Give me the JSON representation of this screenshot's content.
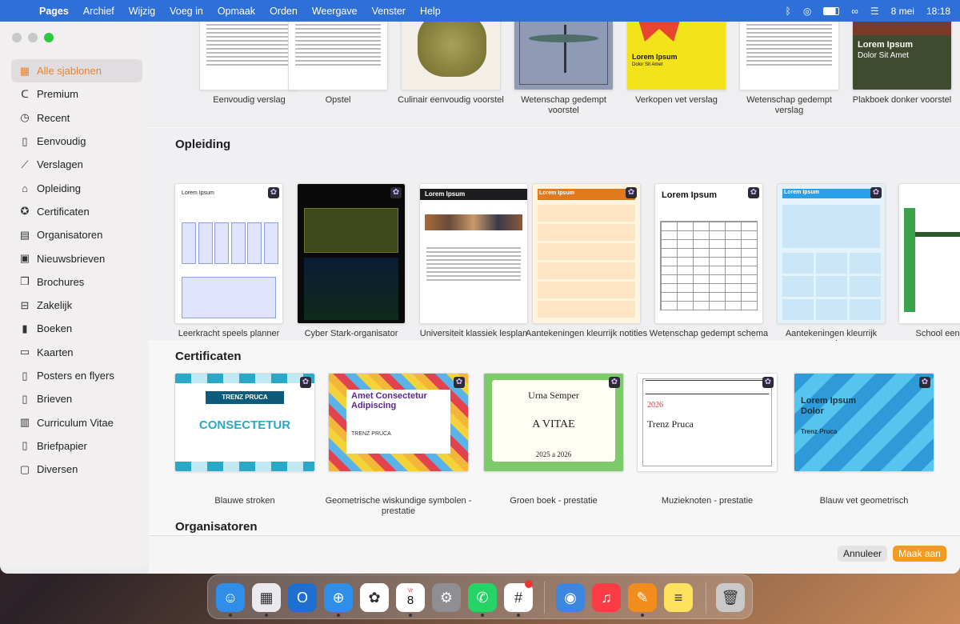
{
  "menubar": {
    "apple": "",
    "items": [
      "Pages",
      "Archief",
      "Wijzig",
      "Voeg in",
      "Opmaak",
      "Orden",
      "Weergave",
      "Venster",
      "Help"
    ],
    "date": "8 mei",
    "time": "18:18"
  },
  "sidebar": {
    "items": [
      {
        "label": "Alle sjablonen",
        "icon": "grid-icon",
        "glyph": "▦",
        "active": true
      },
      {
        "label": "Premium",
        "icon": "premium-icon",
        "glyph": "ᑕ"
      },
      {
        "label": "Recent",
        "icon": "clock-icon",
        "glyph": "◷"
      },
      {
        "label": "Eenvoudig",
        "icon": "document-icon",
        "glyph": "▯"
      },
      {
        "label": "Verslagen",
        "icon": "trend-icon",
        "glyph": "⟋"
      },
      {
        "label": "Opleiding",
        "icon": "graduation-cap-icon",
        "glyph": "⌂"
      },
      {
        "label": "Certificaten",
        "icon": "ribbon-icon",
        "glyph": "✪"
      },
      {
        "label": "Organisatoren",
        "icon": "calendar-icon",
        "glyph": "▤"
      },
      {
        "label": "Nieuwsbrieven",
        "icon": "newsletter-icon",
        "glyph": "▣"
      },
      {
        "label": "Brochures",
        "icon": "brochure-icon",
        "glyph": "❐"
      },
      {
        "label": "Zakelijk",
        "icon": "briefcase-icon",
        "glyph": "⊟"
      },
      {
        "label": "Boeken",
        "icon": "book-icon",
        "glyph": "▮"
      },
      {
        "label": "Kaarten",
        "icon": "card-icon",
        "glyph": "▭"
      },
      {
        "label": "Posters en flyers",
        "icon": "poster-icon",
        "glyph": "▯"
      },
      {
        "label": "Brieven",
        "icon": "letter-icon",
        "glyph": "▯"
      },
      {
        "label": "Curriculum Vitae",
        "icon": "cv-icon",
        "glyph": "▥"
      },
      {
        "label": "Briefpapier",
        "icon": "stationery-icon",
        "glyph": "▯"
      },
      {
        "label": "Diversen",
        "icon": "misc-icon",
        "glyph": "▢"
      }
    ]
  },
  "sections": {
    "top_row": [
      {
        "caption": "Eenvoudig verslag",
        "bg": "#ffffff"
      },
      {
        "caption": "Opstel",
        "bg": "#ffffff"
      },
      {
        "caption": "Culinair eenvoudig voorstel",
        "bg": "#f3efe6"
      },
      {
        "caption": "Wetenschap gedempt voorstel",
        "bg": "#8f9bb5"
      },
      {
        "caption": "Verkopen vet verslag",
        "bg": "#f4e21a"
      },
      {
        "caption": "Wetenschap gedempt verslag",
        "bg": "#ffffff"
      },
      {
        "caption": "Plakboek donker voorstel",
        "bg": "#3f4a30"
      }
    ],
    "top_row_thumb_text": {
      "lorem": "Lorem Ipsum",
      "dolor": "Dolor Sit Amet"
    },
    "opleiding": {
      "title": "Opleiding",
      "items": [
        {
          "caption": "Leerkracht speels planner",
          "bg": "#ffffff",
          "accent": "#8e9ce8"
        },
        {
          "caption": "Cyber Stark-organisator",
          "bg": "#0a0a0a",
          "accent": "#4a5a20"
        },
        {
          "caption": "Universiteit klassiek lesplan",
          "bg": "#ffffff",
          "accent": "#222222"
        },
        {
          "caption": "Aantekeningen kleurrijk notities",
          "bg": "#fff4e0",
          "accent": "#e07a1e"
        },
        {
          "caption": "Wetenschap gedempt schema",
          "bg": "#ffffff",
          "accent": "#cfa27a"
        },
        {
          "caption": "Aantekeningen kleurrijk organizer",
          "bg": "#e3f2fb",
          "accent": "#2aa0e8"
        },
        {
          "caption": "School een lesplan",
          "bg": "#ffffff",
          "accent": "#3aa24a"
        }
      ],
      "thumb_text": "Lorem Ipsum"
    },
    "certificaten": {
      "title": "Certificaten",
      "items": [
        {
          "caption": "Blauwe stroken",
          "bg": "#ffffff",
          "accent": "#29a9c7",
          "line1": "TRENZ PRUCA",
          "line2": "CONSECTETUR"
        },
        {
          "caption": "Geometrische wiskundige symbolen - prestatie",
          "bg": "#fff7ee",
          "accent": "#d64a8c",
          "line1": "Amet Consectetur Adipiscing",
          "line2": "TRENZ PRUCA"
        },
        {
          "caption": "Groen boek - prestatie",
          "bg": "#7dca6a",
          "accent": "#2d2d2d",
          "line1": "Urna Semper",
          "line2": "A VITAE",
          "line3": "2025 a 2026"
        },
        {
          "caption": "Muzieknoten - prestatie",
          "bg": "#ffffff",
          "accent": "#c63b3b",
          "line1": "2026",
          "line2": "Trenz Pruca"
        },
        {
          "caption": "Blauw vet geometrisch",
          "bg": "#37b6e6",
          "accent": "#17323f",
          "line1": "Lorem Ipsum Dolor",
          "line2": "Trenz Pruca"
        }
      ]
    },
    "organisatoren": {
      "title": "Organisatoren"
    }
  },
  "footer": {
    "cancel": "Annuleer",
    "create": "Maak aan"
  },
  "dock": {
    "apps": [
      {
        "name": "finder-icon",
        "bg": "#2e8ee8",
        "glyph": "☺"
      },
      {
        "name": "launchpad-icon",
        "bg": "#e9e9ee",
        "glyph": "▦"
      },
      {
        "name": "outlook-icon",
        "bg": "#1e6fd0",
        "glyph": "O"
      },
      {
        "name": "safari-icon",
        "bg": "#2f8fe8",
        "glyph": "⊕"
      },
      {
        "name": "photos-icon",
        "bg": "#ffffff",
        "glyph": "✿"
      },
      {
        "name": "calendar-icon",
        "bg": "#ffffff",
        "glyph": "8"
      },
      {
        "name": "settings-icon",
        "bg": "#8e8e93",
        "glyph": "⚙"
      },
      {
        "name": "whatsapp-icon",
        "bg": "#25d366",
        "glyph": "✆"
      },
      {
        "name": "slack-icon",
        "bg": "#ffffff",
        "glyph": "#"
      },
      {
        "name": "storage-icon",
        "bg": "#3c86e0",
        "glyph": "◉"
      },
      {
        "name": "music-icon",
        "bg": "#fc3c44",
        "glyph": "♫"
      },
      {
        "name": "pages-icon",
        "bg": "#f28d1d",
        "glyph": "✎"
      },
      {
        "name": "notes-icon",
        "bg": "#fde15b",
        "glyph": "≡"
      },
      {
        "name": "trash-icon",
        "bg": "#c9c9cc",
        "glyph": "🗑"
      }
    ],
    "calendar_day_label": "Vr",
    "calendar_day": "8"
  }
}
